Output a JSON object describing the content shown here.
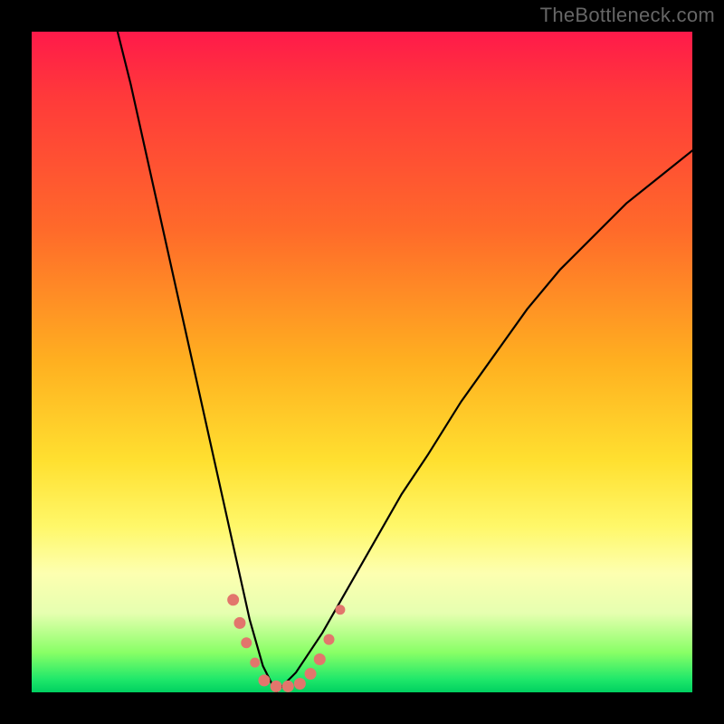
{
  "watermark": "TheBottleneck.com",
  "chart_data": {
    "type": "line",
    "title": "",
    "xlabel": "",
    "ylabel": "",
    "xlim": [
      0,
      100
    ],
    "ylim": [
      0,
      100
    ],
    "curves": {
      "description": "Approximated bottleneck V-curve. Two branches meeting near x≈35. Values are estimated heights on a 0–100 vertical scale where 0 is bottom (green) and 100 is top (red).",
      "left_branch": {
        "x": [
          13,
          15,
          17,
          19,
          21,
          23,
          25,
          27,
          29,
          31,
          33,
          35,
          37
        ],
        "y": [
          100,
          92,
          83,
          74,
          65,
          56,
          47,
          38,
          29,
          20,
          11,
          4,
          0
        ]
      },
      "right_branch": {
        "x": [
          37,
          40,
          44,
          48,
          52,
          56,
          60,
          65,
          70,
          75,
          80,
          85,
          90,
          95,
          100
        ],
        "y": [
          0,
          3,
          9,
          16,
          23,
          30,
          36,
          44,
          51,
          58,
          64,
          69,
          74,
          78,
          82
        ]
      }
    },
    "markers": {
      "description": "Salmon-colored data point markers clustered near the trough of the V.",
      "points": [
        {
          "x": 30.5,
          "y": 14,
          "r": 6
        },
        {
          "x": 31.5,
          "y": 10.5,
          "r": 6
        },
        {
          "x": 32.5,
          "y": 7.5,
          "r": 5.5
        },
        {
          "x": 33.8,
          "y": 4.5,
          "r": 5
        },
        {
          "x": 35.2,
          "y": 1.8,
          "r": 6
        },
        {
          "x": 37.0,
          "y": 0.9,
          "r": 6
        },
        {
          "x": 38.8,
          "y": 0.9,
          "r": 6
        },
        {
          "x": 40.6,
          "y": 1.3,
          "r": 6
        },
        {
          "x": 42.2,
          "y": 2.8,
          "r": 6
        },
        {
          "x": 43.6,
          "y": 5.0,
          "r": 6
        },
        {
          "x": 45.0,
          "y": 8.0,
          "r": 5.5
        },
        {
          "x": 46.7,
          "y": 12.5,
          "r": 5
        }
      ]
    },
    "gradient_stops": [
      {
        "pos": 0.0,
        "color": "#ff1a4a"
      },
      {
        "pos": 0.3,
        "color": "#ff6a2a"
      },
      {
        "pos": 0.65,
        "color": "#ffe030"
      },
      {
        "pos": 0.88,
        "color": "#e6ffb0"
      },
      {
        "pos": 1.0,
        "color": "#00d060"
      }
    ]
  }
}
